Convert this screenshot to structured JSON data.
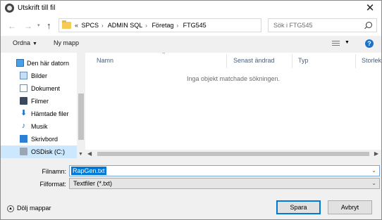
{
  "window": {
    "title": "Utskrift till fil"
  },
  "nav": {
    "back_icon": "back-arrow-icon",
    "forward_icon": "forward-arrow-icon",
    "up_icon": "up-arrow-icon"
  },
  "address": {
    "overflow": "«",
    "crumbs": [
      "SPCS",
      "ADMIN SQL",
      "Företag",
      "FTG545"
    ]
  },
  "search": {
    "placeholder": "Sök i FTG545"
  },
  "toolbar": {
    "organize": "Ordna",
    "new_folder": "Ny mapp",
    "help": "?"
  },
  "sidebar": {
    "items": [
      {
        "label": "Den här datorn",
        "icon": "computer-icon"
      },
      {
        "label": "Bilder",
        "icon": "pictures-icon"
      },
      {
        "label": "Dokument",
        "icon": "documents-icon"
      },
      {
        "label": "Filmer",
        "icon": "videos-icon"
      },
      {
        "label": "Hämtade filer",
        "icon": "downloads-icon"
      },
      {
        "label": "Musik",
        "icon": "music-icon"
      },
      {
        "label": "Skrivbord",
        "icon": "desktop-icon"
      },
      {
        "label": "OSDisk (C:)",
        "icon": "disk-icon"
      }
    ]
  },
  "columns": [
    "Namn",
    "Senast ändrad",
    "Typ",
    "Storlek"
  ],
  "empty_message": "Inga objekt matchade sökningen.",
  "form": {
    "filename_label": "Filnamn:",
    "filename_value": "RapGen.txt",
    "filetype_label": "Filformat:",
    "filetype_value": "Textfiler (*.txt)"
  },
  "footer": {
    "hide_folders": "Dölj mappar",
    "save": "Spara",
    "cancel": "Avbryt"
  },
  "colors": {
    "accent": "#0078d7",
    "selection": "#cce8ff",
    "help": "#1a73c9"
  }
}
